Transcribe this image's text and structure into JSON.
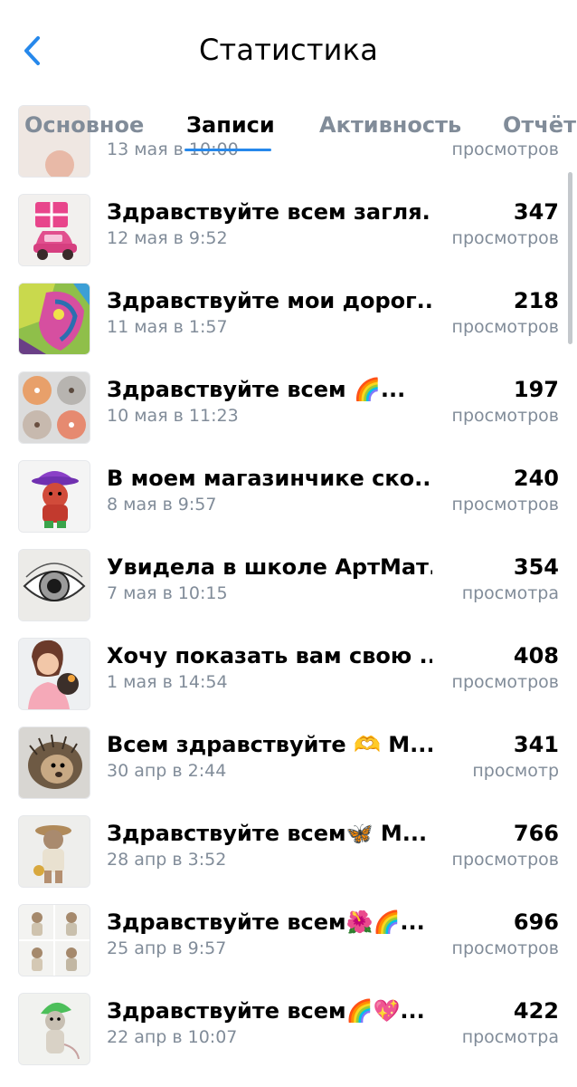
{
  "header": {
    "title": "Статистика"
  },
  "tabs": [
    {
      "label": "Основное",
      "active": false
    },
    {
      "label": "Записи",
      "active": true
    },
    {
      "label": "Активность",
      "active": false
    },
    {
      "label": "Отчёты",
      "active": false
    }
  ],
  "posts": [
    {
      "title": "",
      "date": "13 мая в 10:00",
      "views": "",
      "views_label": "просмотров",
      "thumb": "partial"
    },
    {
      "title": "Здравствуйте всем загля...",
      "date": "12 мая в 9:52",
      "views": "347",
      "views_label": "просмотров",
      "thumb": "pink-car-gift"
    },
    {
      "title": "Здравствуйте мои дорог...",
      "date": "11 мая в 1:57",
      "views": "218",
      "views_label": "просмотров",
      "thumb": "colorful-dog-painting"
    },
    {
      "title": "Здравствуйте всем 🌈...",
      "date": "10 мая в 11:23",
      "views": "197",
      "views_label": "просмотров",
      "thumb": "peach-buttons-grid"
    },
    {
      "title": "В моем магазинчике ско...",
      "date": "8 мая в 9:57",
      "views": "240",
      "views_label": "просмотров",
      "thumb": "doll-purple-hat"
    },
    {
      "title": "Увидела в школе АртМат...",
      "date": "7 мая в 10:15",
      "views": "354",
      "views_label": "просмотра",
      "thumb": "eye-drawing"
    },
    {
      "title": "Хочу показать вам свою ...",
      "date": "1 мая в 14:54",
      "views": "408",
      "views_label": "просмотров",
      "thumb": "woman-with-toy"
    },
    {
      "title": "Всем здравствуйте 🫶 М...",
      "date": "30 апр в 2:44",
      "views": "341",
      "views_label": "просмотр",
      "thumb": "felt-hedgehog"
    },
    {
      "title": "Здравствуйте всем🦋 М...",
      "date": "28 апр в 3:52",
      "views": "766",
      "views_label": "просмотров",
      "thumb": "knitted-mouse"
    },
    {
      "title": "Здравствуйте всем🌺🌈...",
      "date": "25 апр в 9:57",
      "views": "696",
      "views_label": "просмотров",
      "thumb": "mice-collage"
    },
    {
      "title": "Здравствуйте всем🌈💖...",
      "date": "22 апр в 10:07",
      "views": "422",
      "views_label": "просмотра",
      "thumb": "mouse-green-hat"
    }
  ]
}
